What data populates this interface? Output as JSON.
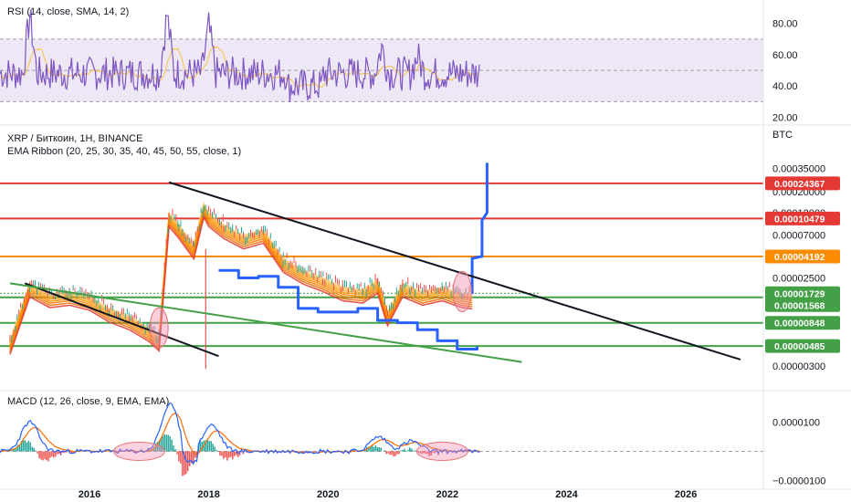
{
  "chart_data": [
    {
      "type": "line",
      "panel": "rsi",
      "title": "RSI (14, close, SMA, 14, 2)",
      "ylim": [
        15,
        95
      ],
      "y_ticks": [
        "80.00",
        "60.00",
        "40.00",
        "20.00"
      ],
      "y_tick_values": [
        80,
        60,
        40,
        20
      ],
      "band": [
        30,
        70
      ],
      "colors": {
        "rsi": "#7e57c2",
        "sma": "#f5c542",
        "band": "#ede7f6"
      }
    },
    {
      "type": "line",
      "panel": "price",
      "title": "XRP / Биткоин, 1H, BINANCE",
      "subtitle": "EMA Ribbon (20, 25, 30, 35, 40, 45, 50, 55, close, 1)",
      "currency": "BTC",
      "scale": "log",
      "y_ticks": [
        "0.00035000",
        "0.00020000",
        "0.00012000",
        "0.00007000",
        "0.00002500",
        "0.00000800",
        "0.00000500",
        "0.00000300"
      ],
      "y_tick_values": [
        0.00035,
        0.0002,
        0.00012,
        7e-05,
        2.5e-05,
        8e-06,
        5e-06,
        3e-06
      ],
      "levels": [
        {
          "label": "0.00024367",
          "value": 0.00024367,
          "color": "#e53935"
        },
        {
          "label": "0.00010479",
          "value": 0.00010479,
          "color": "#e53935"
        },
        {
          "label": "0.00004192",
          "value": 4.192e-05,
          "color": "#fb8c00"
        },
        {
          "label": "0.00001729",
          "value": 1.729e-05,
          "color": "#43a047"
        },
        {
          "label": "0.00001568",
          "value": 1.568e-05,
          "color": "#43a047"
        },
        {
          "label": "0.00000848",
          "value": 8.48e-06,
          "color": "#43a047"
        },
        {
          "label": "0.00000485",
          "value": 4.85e-06,
          "color": "#43a047"
        }
      ],
      "series": [
        {
          "kind": "price",
          "x": [
            "2014-09",
            "2015-01",
            "2015-05",
            "2015-09",
            "2016-01",
            "2016-05",
            "2016-09",
            "2017-01",
            "2017-03",
            "2017-05",
            "2017-07",
            "2017-10",
            "2017-12",
            "2018-01",
            "2018-04",
            "2018-08",
            "2018-12",
            "2019-04",
            "2019-08",
            "2019-12",
            "2020-04",
            "2020-08",
            "2020-11",
            "2021-01",
            "2021-04",
            "2021-08",
            "2021-12",
            "2022-04",
            "2022-06"
          ],
          "values": [
            5.5e-06,
            2.2e-05,
            1.7e-05,
            1.8e-05,
            1.6e-05,
            1.2e-05,
            1e-05,
            7.5e-06,
            6e-06,
            0.00012,
            9e-05,
            5.5e-05,
            0.00015,
            0.00012,
            9e-05,
            7e-05,
            8e-05,
            4e-05,
            3e-05,
            2.5e-05,
            2e-05,
            1.9e-05,
            2.4e-05,
            1.1e-05,
            2.2e-05,
            1.8e-05,
            2e-05,
            1.7e-05,
            1.65e-05
          ]
        },
        {
          "kind": "projection",
          "x": [
            "2018-03",
            "2018-07",
            "2018-11",
            "2019-03",
            "2019-07",
            "2019-11",
            "2020-03",
            "2020-07",
            "2020-11",
            "2021-03",
            "2021-07",
            "2021-11",
            "2022-03",
            "2022-07"
          ],
          "values": [
            3e-05,
            2.5e-05,
            2.6e-05,
            2e-05,
            1.2e-05,
            1.1e-05,
            1.1e-05,
            1.2e-05,
            9e-06,
            8.5e-06,
            7.2e-06,
            5.5e-06,
            4.5e-06,
            4.8e-06
          ]
        },
        {
          "kind": "projection-spike",
          "x": [
            "2022-06",
            "2022-06",
            "2022-08",
            "2022-08",
            "2022-09",
            "2022-09"
          ],
          "values": [
            1.7e-05,
            4e-05,
            4.2e-05,
            0.0001,
            0.00012,
            0.0004
          ]
        }
      ],
      "trendlines": [
        {
          "color": "#131722",
          "x": [
            "2017-05",
            "2026-12"
          ],
          "values": [
            0.00025,
            3.5e-06
          ]
        },
        {
          "color": "#131722",
          "x": [
            "2014-12",
            "2018-03"
          ],
          "values": [
            2.2e-05,
            3.8e-06
          ]
        },
        {
          "color": "#43a047",
          "x": [
            "2014-09",
            "2023-04"
          ],
          "values": [
            2.2e-05,
            3.3e-06
          ]
        }
      ],
      "annotations": [
        {
          "shape": "ellipse",
          "x": "2017-03",
          "value": 7.5e-06,
          "color": "#f48fb1"
        },
        {
          "shape": "ellipse",
          "x": "2022-04",
          "value": 1.8e-05,
          "color": "#f48fb1"
        }
      ]
    },
    {
      "type": "bar",
      "panel": "macd",
      "title": "MACD (12, 26, close, 9, EMA, EMA)",
      "ylim": [
        -1.3e-06,
        1.8e-06
      ],
      "y_ticks": [
        "0.0000100",
        "−0.0000100"
      ],
      "y_tick_values": [
        1e-06,
        -1e-06
      ],
      "colors": {
        "macd": "#2962ff",
        "signal": "#ff6d00",
        "hist_pos": "#26a69a",
        "hist_neg": "#ef5350"
      },
      "annotations": [
        {
          "shape": "ellipse",
          "x": "2016-11",
          "color": "#f48fb1"
        },
        {
          "shape": "ellipse",
          "x": "2021-12",
          "color": "#f48fb1"
        }
      ]
    }
  ],
  "x_axis": {
    "ticks": [
      "2016",
      "2018",
      "2020",
      "2022",
      "2024",
      "2026"
    ]
  }
}
